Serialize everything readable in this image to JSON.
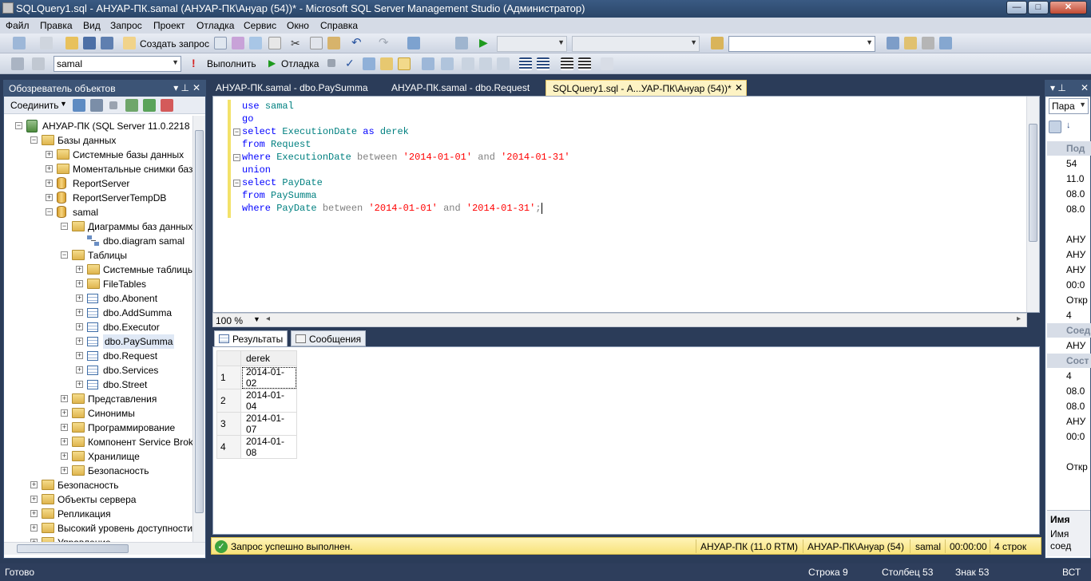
{
  "window": {
    "title": "SQLQuery1.sql - АНУАР-ПК.samal (АНУАР-ПК\\Ануар (54))* - Microsoft SQL Server Management Studio (Администратор)",
    "min": "—",
    "max": "□",
    "close": "✕"
  },
  "menu": [
    "Файл",
    "Правка",
    "Вид",
    "Запрос",
    "Проект",
    "Отладка",
    "Сервис",
    "Окно",
    "Справка"
  ],
  "toolbar1": {
    "new_query": "Создать запрос"
  },
  "toolbar2": {
    "database": "samal",
    "execute": "Выполнить",
    "debug": "Отладка"
  },
  "object_explorer": {
    "title": "Обозреватель объектов",
    "connect": "Соединить",
    "tree": [
      {
        "label": "АНУАР-ПК (SQL Server 11.0.2218 - А",
        "level": 0,
        "icon": "server-icon",
        "expanded": true
      },
      {
        "label": "Базы данных",
        "level": 1,
        "icon": "folder-icon",
        "expanded": true
      },
      {
        "label": "Системные базы данных",
        "level": 2,
        "icon": "folder-icon",
        "expanded": false
      },
      {
        "label": "Моментальные снимки баз",
        "level": 2,
        "icon": "folder-icon",
        "expanded": false
      },
      {
        "label": "ReportServer",
        "level": 2,
        "icon": "database-icon",
        "expanded": false
      },
      {
        "label": "ReportServerTempDB",
        "level": 2,
        "icon": "database-icon",
        "expanded": false
      },
      {
        "label": "samal",
        "level": 2,
        "icon": "database-icon",
        "expanded": true
      },
      {
        "label": "Диаграммы баз данных",
        "level": 3,
        "icon": "folder-icon",
        "expanded": true
      },
      {
        "label": "dbo.diagram samal",
        "level": 4,
        "icon": "diagram-icon",
        "leaf": true
      },
      {
        "label": "Таблицы",
        "level": 3,
        "icon": "folder-icon",
        "expanded": true
      },
      {
        "label": "Системные таблицы",
        "level": 4,
        "icon": "folder-icon",
        "expanded": false
      },
      {
        "label": "FileTables",
        "level": 4,
        "icon": "folder-icon",
        "expanded": false
      },
      {
        "label": "dbo.Abonent",
        "level": 4,
        "icon": "table-icon",
        "expanded": false
      },
      {
        "label": "dbo.AddSumma",
        "level": 4,
        "icon": "table-icon",
        "expanded": false
      },
      {
        "label": "dbo.Executor",
        "level": 4,
        "icon": "table-icon",
        "expanded": false
      },
      {
        "label": "dbo.PaySumma",
        "level": 4,
        "icon": "table-icon",
        "expanded": false,
        "selected": true
      },
      {
        "label": "dbo.Request",
        "level": 4,
        "icon": "table-icon",
        "expanded": false
      },
      {
        "label": "dbo.Services",
        "level": 4,
        "icon": "table-icon",
        "expanded": false
      },
      {
        "label": "dbo.Street",
        "level": 4,
        "icon": "table-icon",
        "expanded": false
      },
      {
        "label": "Представления",
        "level": 3,
        "icon": "folder-icon",
        "expanded": false
      },
      {
        "label": "Синонимы",
        "level": 3,
        "icon": "folder-icon",
        "expanded": false
      },
      {
        "label": "Программирование",
        "level": 3,
        "icon": "folder-icon",
        "expanded": false
      },
      {
        "label": "Компонент Service Broke",
        "level": 3,
        "icon": "folder-icon",
        "expanded": false
      },
      {
        "label": "Хранилище",
        "level": 3,
        "icon": "folder-icon",
        "expanded": false
      },
      {
        "label": "Безопасность",
        "level": 3,
        "icon": "folder-icon",
        "expanded": false
      },
      {
        "label": "Безопасность",
        "level": 1,
        "icon": "folder-icon",
        "expanded": false
      },
      {
        "label": "Объекты сервера",
        "level": 1,
        "icon": "folder-icon",
        "expanded": false
      },
      {
        "label": "Репликация",
        "level": 1,
        "icon": "folder-icon",
        "expanded": false
      },
      {
        "label": "Высокий уровень доступности",
        "level": 1,
        "icon": "folder-icon",
        "expanded": false
      },
      {
        "label": "Управление",
        "level": 1,
        "icon": "folder-icon",
        "expanded": false
      }
    ]
  },
  "tabs": [
    {
      "label": "АНУАР-ПК.samal - dbo.PaySumma",
      "active": false
    },
    {
      "label": "АНУАР-ПК.samal - dbo.Request",
      "active": false
    },
    {
      "label": "SQLQuery1.sql - А...УАР-ПК\\Ануар (54))*",
      "active": true
    }
  ],
  "editor": {
    "lines": [
      [
        [
          "kw",
          "use"
        ],
        [
          "sp",
          " "
        ],
        [
          "id",
          "samal"
        ]
      ],
      [
        [
          "kw",
          "go"
        ]
      ],
      [
        [
          "kw",
          "select"
        ],
        [
          "sp",
          " "
        ],
        [
          "id",
          "ExecutionDate"
        ],
        [
          "sp",
          " "
        ],
        [
          "kw",
          "as"
        ],
        [
          "sp",
          " "
        ],
        [
          "id",
          "derek"
        ]
      ],
      [
        [
          "kw",
          "from"
        ],
        [
          "sp",
          " "
        ],
        [
          "id",
          "Request"
        ]
      ],
      [
        [
          "kw",
          "where"
        ],
        [
          "sp",
          " "
        ],
        [
          "id",
          "ExecutionDate"
        ],
        [
          "sp",
          " "
        ],
        [
          "op",
          "between"
        ],
        [
          "sp",
          " "
        ],
        [
          "str",
          "'2014-01-01'"
        ],
        [
          "sp",
          " "
        ],
        [
          "op",
          "and"
        ],
        [
          "sp",
          " "
        ],
        [
          "str",
          "'2014-01-31'"
        ]
      ],
      [
        [
          "kw",
          "union"
        ]
      ],
      [
        [
          "kw",
          "select"
        ],
        [
          "sp",
          " "
        ],
        [
          "id",
          "PayDate"
        ]
      ],
      [
        [
          "kw",
          "from"
        ],
        [
          "sp",
          " "
        ],
        [
          "id",
          "PaySumma"
        ]
      ],
      [
        [
          "kw",
          "where"
        ],
        [
          "sp",
          " "
        ],
        [
          "id",
          "PayDate"
        ],
        [
          "sp",
          " "
        ],
        [
          "op",
          "between"
        ],
        [
          "sp",
          " "
        ],
        [
          "str",
          "'2014-01-01'"
        ],
        [
          "sp",
          " "
        ],
        [
          "op",
          "and"
        ],
        [
          "sp",
          " "
        ],
        [
          "str",
          "'2014-01-31'"
        ],
        [
          "op",
          ";"
        ]
      ]
    ],
    "zoom": "100 %"
  },
  "results": {
    "tabs": [
      "Результаты",
      "Сообщения"
    ],
    "columns": [
      "derek"
    ],
    "rows": [
      [
        "1",
        "2014-01-02"
      ],
      [
        "2",
        "2014-01-04"
      ],
      [
        "3",
        "2014-01-07"
      ],
      [
        "4",
        "2014-01-08"
      ]
    ]
  },
  "status": {
    "message": "Запрос успешно выполнен.",
    "server": "АНУАР-ПК (11.0 RTM)",
    "user": "АНУАР-ПК\\Ануар (54)",
    "db": "samal",
    "time": "00:00:00",
    "rows": "4 строк"
  },
  "properties": {
    "dropdown": "Пара",
    "values": [
      {
        "kind": "cat",
        "text": "Под"
      },
      {
        "kind": "val",
        "text": "54"
      },
      {
        "kind": "val",
        "text": "11.0"
      },
      {
        "kind": "val",
        "text": "08.0"
      },
      {
        "kind": "val",
        "text": "08.0"
      },
      {
        "kind": "val",
        "text": ""
      },
      {
        "kind": "val",
        "text": "АНУ"
      },
      {
        "kind": "val",
        "text": "АНУ"
      },
      {
        "kind": "val",
        "text": "АНУ"
      },
      {
        "kind": "val",
        "text": "00:0"
      },
      {
        "kind": "val",
        "text": "Откр"
      },
      {
        "kind": "val",
        "text": "4"
      },
      {
        "kind": "cat",
        "text": "Соед"
      },
      {
        "kind": "val",
        "text": "АНУ"
      },
      {
        "kind": "cat",
        "text": "Сост"
      },
      {
        "kind": "val",
        "text": "4"
      },
      {
        "kind": "val",
        "text": "08.0"
      },
      {
        "kind": "val",
        "text": "08.0"
      },
      {
        "kind": "val",
        "text": "АНУ"
      },
      {
        "kind": "val",
        "text": "00:0"
      },
      {
        "kind": "val",
        "text": ""
      },
      {
        "kind": "val",
        "text": "Откр"
      }
    ],
    "name_title": "Имя",
    "name_desc1": "Имя",
    "name_desc2": "соед"
  },
  "bottom": {
    "ready": "Готово",
    "line": "Строка 9",
    "col": "Столбец 53",
    "ch": "Знак 53",
    "mode": "ВСТ"
  }
}
